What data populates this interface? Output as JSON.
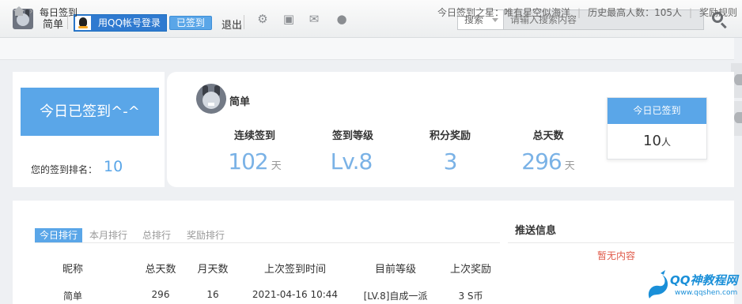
{
  "topbar": {
    "username": "简单",
    "qq_login_label": "用QQ帐号登录",
    "signed_badge": "已签到",
    "logout_label": "退出",
    "icons": [
      "gear-icon",
      "image-icon",
      "mail-icon",
      "bulb-icon"
    ],
    "search_scope": "搜索",
    "search_placeholder": "请输入搜索内容"
  },
  "breadcrumb": {
    "page": "每日签到",
    "separator": "›",
    "star_today": "今日签到之星：唯有星空似海洋",
    "record": "历史最高人数：105人",
    "rules": "奖励规则"
  },
  "sign_panel": {
    "big_status": "今日已签到^-^",
    "rank_label": "您的签到排名：",
    "rank_value": "10",
    "user_name": "简单",
    "stats": [
      {
        "label": "连续签到",
        "value": "102",
        "unit": "天"
      },
      {
        "label": "签到等级",
        "value": "Lv.8",
        "unit": ""
      },
      {
        "label": "积分奖励",
        "value": "3",
        "unit": ""
      },
      {
        "label": "总天数",
        "value": "296",
        "unit": "天"
      }
    ],
    "today_box_title": "今日已签到",
    "today_count": "10",
    "today_unit": "人"
  },
  "ranking": {
    "tabs": [
      "今日排行",
      "本月排行",
      "总排行",
      "奖励排行"
    ],
    "columns": [
      "昵称",
      "总天数",
      "月天数",
      "上次签到时间",
      "目前等级",
      "上次奖励"
    ],
    "rows": [
      [
        "简单",
        "296",
        "16",
        "2021-04-16 10:44",
        "[LV.8]自成一派",
        "3 S币"
      ]
    ]
  },
  "push": {
    "title": "推送信息",
    "empty": "暂无内容"
  },
  "watermark": {
    "title": "QQ神教程网",
    "url": "www.qqshen.com"
  },
  "colors": {
    "accent": "#5aa6e8",
    "stat_value": "#7ab2e6",
    "empty_text": "#e05a4a"
  }
}
